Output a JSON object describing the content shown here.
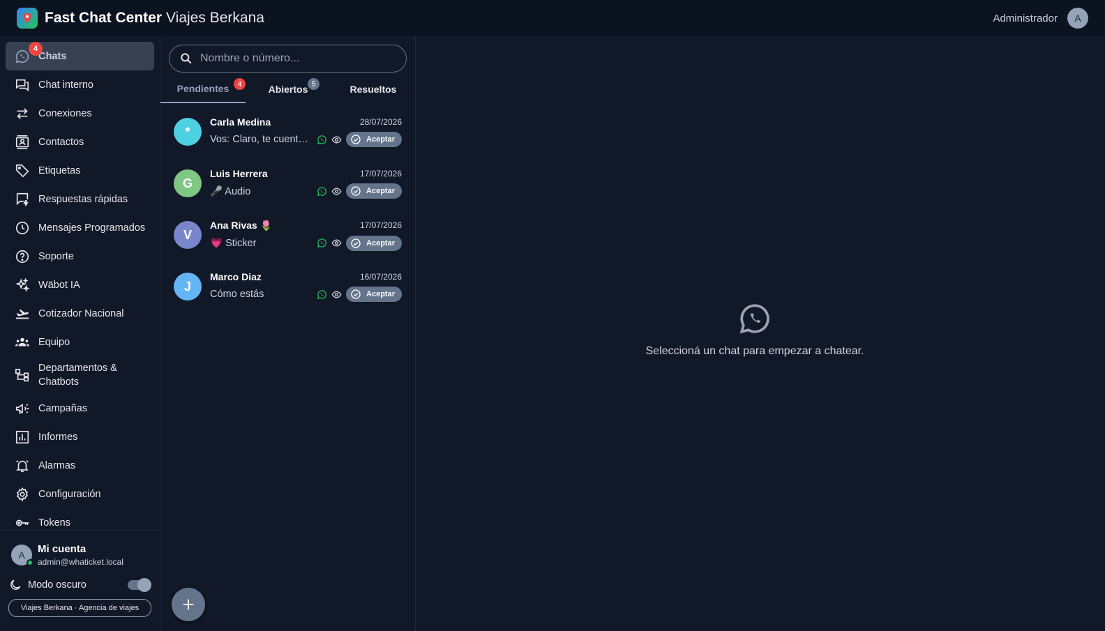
{
  "header": {
    "brand": "Fast Chat Center",
    "company": "Viajes Berkana",
    "user_label": "Administrador",
    "user_initial": "A"
  },
  "sidebar": {
    "items": [
      {
        "label": "Chats",
        "icon": "whatsapp-icon",
        "badge": "4",
        "active": true
      },
      {
        "label": "Chat interno",
        "icon": "forum-icon"
      },
      {
        "label": "Conexiones",
        "icon": "swap-arrows-icon"
      },
      {
        "label": "Contactos",
        "icon": "contacts-icon"
      },
      {
        "label": "Etiquetas",
        "icon": "tag-icon"
      },
      {
        "label": "Respuestas rápidas",
        "icon": "quick-reply-icon"
      },
      {
        "label": "Mensajes Programados",
        "icon": "clock-icon"
      },
      {
        "label": "Soporte",
        "icon": "help-icon"
      },
      {
        "label": "Wäbot IA",
        "icon": "sparkle-icon"
      },
      {
        "label": "Cotizador Nacional",
        "icon": "airplane-icon"
      },
      {
        "label": "Equipo",
        "icon": "group-icon"
      },
      {
        "label": "Departamentos & Chatbots",
        "icon": "hierarchy-icon"
      },
      {
        "label": "Campañas",
        "icon": "megaphone-icon"
      },
      {
        "label": "Informes",
        "icon": "chart-icon"
      },
      {
        "label": "Alarmas",
        "icon": "bell-icon"
      },
      {
        "label": "Configuración",
        "icon": "gear-icon"
      },
      {
        "label": "Tokens",
        "icon": "key-icon"
      }
    ],
    "account": {
      "title": "Mi cuenta",
      "email": "admin@whaticket.local",
      "initial": "A"
    },
    "dark_mode_label": "Modo oscuro",
    "company_pill": "Viajes Berkana · Agencia de viajes"
  },
  "chatlist": {
    "search_placeholder": "Nombre o número...",
    "tabs": [
      {
        "label": "Pendientes",
        "badge": "4"
      },
      {
        "label": "Abiertos",
        "badge": "5"
      },
      {
        "label": "Resueltos"
      }
    ],
    "accept_label": "Aceptar",
    "chats": [
      {
        "initial": "*",
        "name": "Carla Medina",
        "date": "28/07/2026",
        "message": "Vos: Claro, te cuento ...",
        "color": "#4dd0e1"
      },
      {
        "initial": "G",
        "name": "Luis Herrera",
        "date": "17/07/2026",
        "message": "🎤 Audio",
        "color": "#81c784"
      },
      {
        "initial": "V",
        "name": "Ana Rivas 🌷",
        "date": "17/07/2026",
        "message": "💗 Sticker",
        "color": "#7986cb"
      },
      {
        "initial": "J",
        "name": "Marco Diaz",
        "date": "16/07/2026",
        "message": "Cómo estás",
        "color": "#64b5f6"
      }
    ]
  },
  "main": {
    "empty_text": "Seleccioná un chat para empezar a chatear."
  },
  "colors": {
    "header_bg": "#0b1220",
    "panel_bg": "#111827",
    "active_item": "#374151",
    "accent_grey": "#64748b",
    "badge_red": "#ef4444",
    "whatsapp_green": "#22c55e"
  }
}
